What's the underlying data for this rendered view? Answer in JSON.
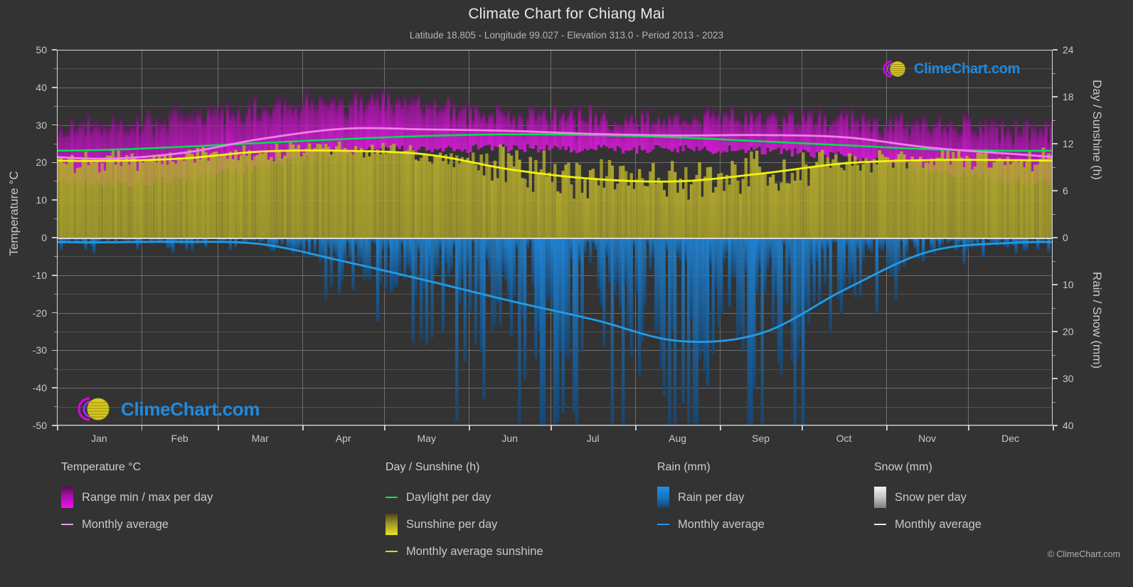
{
  "header": {
    "title": "Climate Chart for Chiang Mai",
    "subtitle": "Latitude 18.805 - Longitude 99.027 - Elevation 313.0 - Period 2013 - 2023"
  },
  "axes": {
    "left_title": "Temperature °C",
    "right_top_title": "Day / Sunshine (h)",
    "right_bottom_title": "Rain / Snow (mm)",
    "left_ticks": [
      "50",
      "40",
      "30",
      "20",
      "10",
      "0",
      "-10",
      "-20",
      "-30",
      "-40",
      "-50"
    ],
    "right_top_ticks": [
      "24",
      "18",
      "12",
      "6",
      "0"
    ],
    "right_bottom_ticks": [
      "0",
      "10",
      "20",
      "30",
      "40"
    ],
    "x_ticks": [
      "Jan",
      "Feb",
      "Mar",
      "Apr",
      "May",
      "Jun",
      "Jul",
      "Aug",
      "Sep",
      "Oct",
      "Nov",
      "Dec"
    ]
  },
  "legend": {
    "temperature": {
      "heading": "Temperature °C",
      "items": [
        {
          "label": "Range min / max per day",
          "marker": "gradient-swatch-magenta"
        },
        {
          "label": "Monthly average",
          "marker": "line-pink"
        }
      ]
    },
    "day_sunshine": {
      "heading": "Day / Sunshine (h)",
      "items": [
        {
          "label": "Daylight per day",
          "marker": "line-green"
        },
        {
          "label": "Sunshine per day",
          "marker": "gradient-swatch-yellow"
        },
        {
          "label": "Monthly average sunshine",
          "marker": "line-yellow"
        }
      ]
    },
    "rain": {
      "heading": "Rain (mm)",
      "items": [
        {
          "label": "Rain per day",
          "marker": "gradient-swatch-blue"
        },
        {
          "label": "Monthly average",
          "marker": "line-blue"
        }
      ]
    },
    "snow": {
      "heading": "Snow (mm)",
      "items": [
        {
          "label": "Snow per day",
          "marker": "gradient-swatch-white"
        },
        {
          "label": "Monthly average",
          "marker": "line-white"
        }
      ]
    }
  },
  "branding": {
    "name": "ClimeChart.com",
    "copyright": "© ClimeChart.com"
  },
  "colors": {
    "background": "#333333",
    "temp_range": "#d400d4",
    "temp_avg_line": "#f080e8",
    "daylight_line": "#00e050",
    "sunshine_fill": "#a8a02c",
    "sunshine_avg_line": "#f2f20a",
    "rain_fill": "#1f7fd0",
    "rain_avg_line": "#1f9ce8",
    "snow_fill": "#ffffff",
    "grid": "#bebebe",
    "text": "#c8c8c8",
    "brand_blue": "#1f8ae0",
    "brand_magenta": "#e000e0",
    "brand_yellow": "#e8d018"
  },
  "chart_data": {
    "type": "area",
    "title": "Climate Chart for Chiang Mai",
    "subtitle": "Latitude 18.805 - Longitude 99.027 - Elevation 313.0 - Period 2013 - 2023",
    "xlabel": "",
    "ylabel": "Temperature °C",
    "categories": [
      "Jan",
      "Feb",
      "Mar",
      "Apr",
      "May",
      "Jun",
      "Jul",
      "Aug",
      "Sep",
      "Oct",
      "Nov",
      "Dec"
    ],
    "axis_left": {
      "label": "Temperature °C",
      "min": -50,
      "max": 50,
      "step": 10,
      "unit": "°C"
    },
    "axis_right_top": {
      "label": "Day / Sunshine (h)",
      "min": 0,
      "max": 24,
      "step": 6,
      "unit": "h"
    },
    "axis_right_bottom": {
      "label": "Rain / Snow (mm)",
      "min": 0,
      "max": 40,
      "step": 10,
      "unit": "mm"
    },
    "grid": true,
    "legend_position": "below",
    "series": [
      {
        "name": "Monthly average temperature",
        "unit": "°C",
        "axis": "left",
        "color": "#f080e8",
        "values": [
          21.0,
          22.5,
          26.3,
          29.0,
          28.8,
          28.4,
          27.6,
          27.2,
          27.3,
          26.7,
          24.0,
          22.3
        ]
      },
      {
        "name": "Range min / max per day",
        "unit": "°C",
        "axis": "left",
        "color": "#d400d4",
        "min_values": [
          14.5,
          15.5,
          19.0,
          22.5,
          23.5,
          23.8,
          23.6,
          23.5,
          23.2,
          21.5,
          18.0,
          15.0
        ],
        "max_values": [
          30.5,
          33.0,
          36.0,
          37.0,
          35.5,
          33.5,
          32.5,
          32.0,
          32.5,
          32.0,
          31.0,
          30.0
        ]
      },
      {
        "name": "Daylight per day",
        "unit": "h",
        "axis": "right_top",
        "color": "#00e050",
        "values": [
          11.2,
          11.6,
          12.1,
          12.6,
          13.0,
          13.2,
          13.1,
          12.8,
          12.3,
          11.8,
          11.3,
          11.1
        ]
      },
      {
        "name": "Monthly average sunshine",
        "unit": "h",
        "axis": "right_top",
        "color": "#f2f20a",
        "values": [
          9.8,
          10.1,
          11.0,
          11.1,
          10.6,
          8.7,
          7.5,
          7.2,
          8.2,
          9.5,
          9.9,
          9.9
        ]
      },
      {
        "name": "Rain monthly average",
        "unit": "mm",
        "axis": "right_bottom",
        "color": "#1f9ce8",
        "values": [
          1.0,
          0.9,
          1.4,
          5.1,
          9.2,
          13.5,
          17.5,
          22.0,
          20.3,
          11.0,
          3.0,
          1.1
        ]
      },
      {
        "name": "Snow monthly average",
        "unit": "mm",
        "axis": "right_bottom",
        "color": "#ffffff",
        "values": [
          0,
          0,
          0,
          0,
          0,
          0,
          0,
          0,
          0,
          0,
          0,
          0
        ]
      }
    ]
  }
}
